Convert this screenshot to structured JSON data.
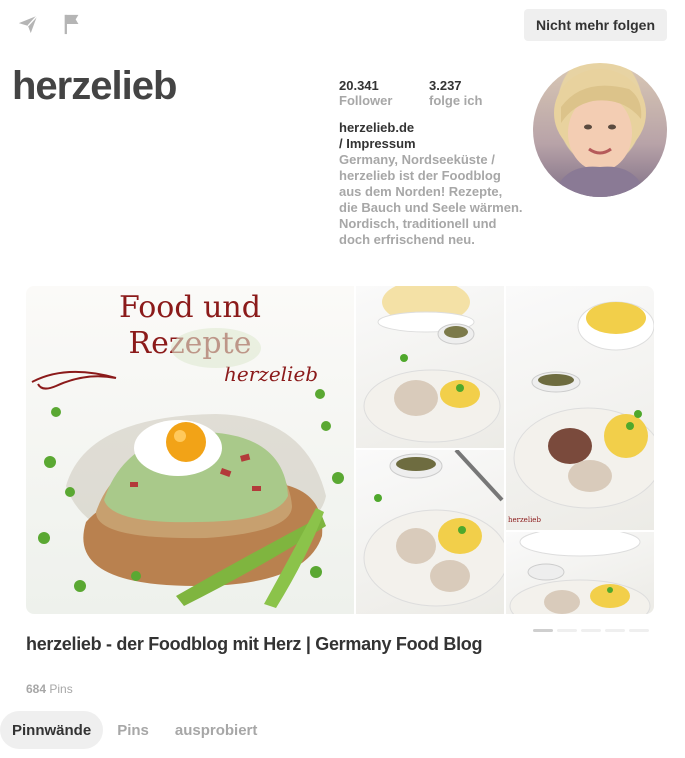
{
  "header": {
    "unfollow_label": "Nicht mehr folgen",
    "icons": [
      "send-icon",
      "flag-icon"
    ]
  },
  "profile": {
    "name": "herzelieb",
    "followers_count": "20.341",
    "followers_label": "Follower",
    "following_count": "3.237",
    "following_label": "folge ich",
    "website": "herzelieb.de",
    "imprint": "/ Impressum",
    "bio": "Germany, Nordseeküste / herzelieb ist der Foodblog aus dem Norden! Rezepte, die Bauch und Seele wärmen. Nordisch, traditionell und doch erfrischend neu."
  },
  "board": {
    "cover_line1": "Food und",
    "cover_line2": "Rezepte",
    "cover_brand": "herzelieb",
    "tile_brand": "herzelieb",
    "title": "herzelieb - der Foodblog mit Herz | Germany Food Blog",
    "pin_count": "684",
    "pin_label": " Pins"
  },
  "tabs": [
    {
      "label": "Pinnwände",
      "active": true
    },
    {
      "label": "Pins",
      "active": false
    },
    {
      "label": "ausprobiert",
      "active": false
    }
  ],
  "colors": {
    "accent_red": "#8b1a1a",
    "muted_text": "#a7a7a7",
    "button_bg": "#efefef"
  }
}
